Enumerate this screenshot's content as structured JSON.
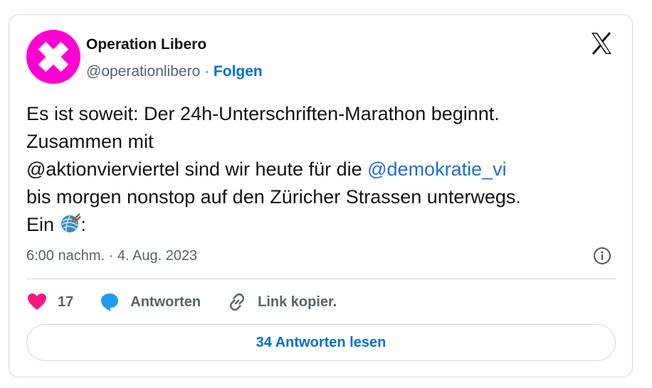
{
  "author": {
    "name": "Operation Libero",
    "handle": "@operationlibero",
    "separator": " · ",
    "follow_label": "Folgen"
  },
  "icons": {
    "avatar": "x-cross-logo-icon",
    "brand": "x-logo-icon",
    "info": "info-icon",
    "like": "heart-icon",
    "reply": "speech-bubble-icon",
    "link": "link-icon",
    "emoji": "yarn-ball-icon"
  },
  "colors": {
    "avatar_bg": "#ff00d2",
    "link_blue": "#006fd6",
    "like_red": "#f91880",
    "reply_blue": "#1d9bf0"
  },
  "tweet": {
    "line1": "Es ist soweit: Der 24h-Unterschriften-Marathon beginnt.",
    "line2": "Zusammen mit",
    "line3_prefix": "@aktionvierviertel sind wir heute für die ",
    "line3_mention": "@demokratie_vi",
    "line4": "bis morgen nonstop auf den Züricher Strassen unterwegs.",
    "line5_prefix": "Ein ",
    "line5_suffix": ":"
  },
  "meta": {
    "time": "6:00 nachm.",
    "separator": " · ",
    "date": "4. Aug. 2023"
  },
  "actions": {
    "like_count": "17",
    "reply_label": "Antworten",
    "link_label": "Link kopier."
  },
  "footer": {
    "read_replies_label": "34 Antworten lesen"
  }
}
